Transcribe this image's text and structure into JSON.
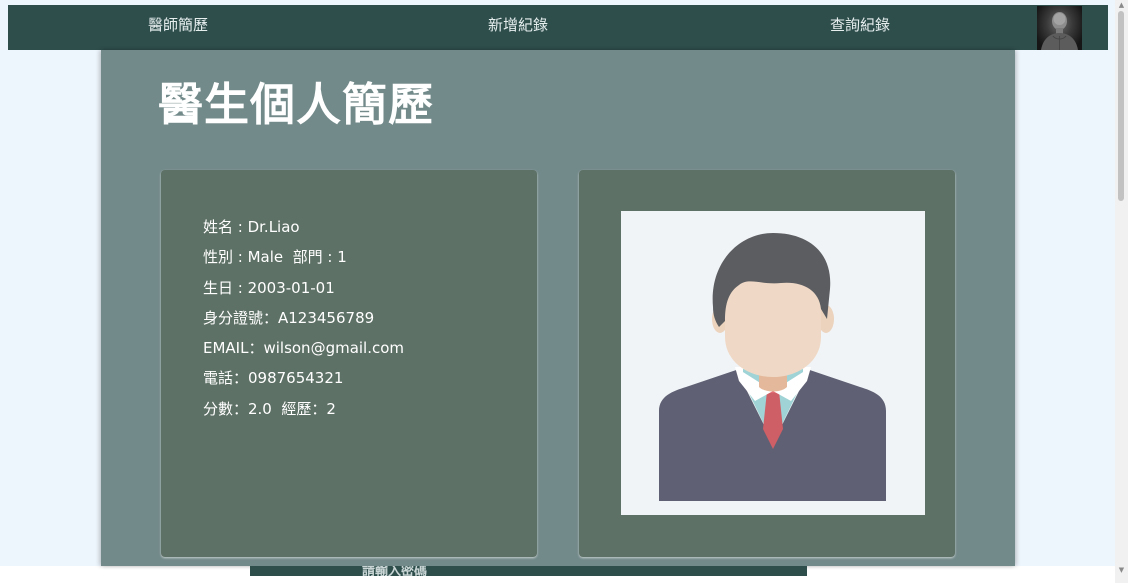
{
  "navbar": {
    "links": [
      "醫師簡歷",
      "新增紀錄",
      "查詢紀錄"
    ],
    "avatar_icon": "user-avatar-photo"
  },
  "main": {
    "title": "醫生個人簡歷",
    "info": [
      "姓名 : Dr.Liao",
      "性別 : Male  部門 : 1",
      "生日 : 2003-01-01",
      "身分證號：A123456789",
      "EMAIL：wilson@gmail.com",
      "電話：0987654321",
      "分數：2.0  經歷：2"
    ],
    "photo_icon": "person-placeholder-icon"
  },
  "footer": {
    "partial_text": "請輸入密碼"
  },
  "colors": {
    "navbar": "#2e4e4c",
    "main_panel": "#738a8a",
    "card": "#5e7166",
    "page_background": "#eef6fd"
  },
  "icons": {
    "scroll_up": "scroll-up-arrow-icon",
    "scroll_down": "scroll-down-arrow-icon"
  }
}
